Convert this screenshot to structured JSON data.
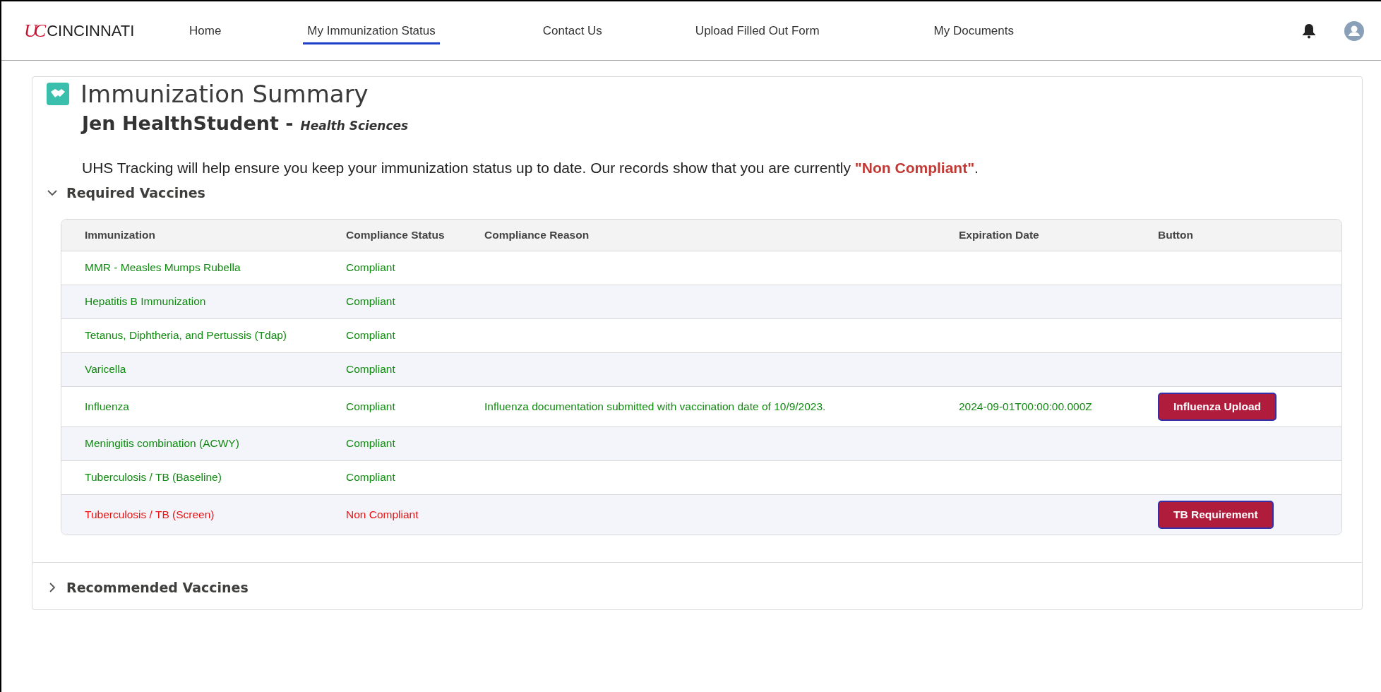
{
  "header": {
    "logo_mark": "UC",
    "logo_text": "CINCINNATI",
    "nav": [
      {
        "label": "Home",
        "selected": false
      },
      {
        "label": "My Immunization Status",
        "selected": true
      },
      {
        "label": "Contact Us",
        "selected": false
      },
      {
        "label": "Upload Filled Out Form",
        "selected": false
      },
      {
        "label": "My Documents",
        "selected": false
      }
    ]
  },
  "summary": {
    "title": "Immunization Summary",
    "student": "Jen HealthStudent -",
    "program": "Health Sciences",
    "message": "UHS Tracking will help ensure you keep your immunization status up to date. Our records show that you are currently **\"Non Compliant\"**.",
    "sections": [
      {
        "label": "Required Vaccines",
        "expanded": true,
        "table": {
          "columns": [
            "Immunization",
            "Compliance Status",
            "Compliance Reason",
            "Expiration Date",
            "Button"
          ],
          "rows": [
            {
              "immunization": "MMR - Measles Mumps Rubella",
              "status": "Compliant",
              "compliant": true
            },
            {
              "immunization": "Hepatitis B Immunization",
              "status": "Compliant",
              "compliant": true
            },
            {
              "immunization": "Tetanus, Diphtheria, and Pertussis (Tdap)",
              "status": "Compliant",
              "compliant": true
            },
            {
              "immunization": "Varicella",
              "status": "Compliant",
              "compliant": true
            },
            {
              "immunization": "Influenza",
              "status": "Compliant",
              "compliant": true,
              "reason": "Influenza documentation submitted with vaccination date of 10/9/2023.",
              "expiration": "2024-09-01T00:00:00.000Z",
              "button": "Influenza Upload"
            },
            {
              "immunization": "Meningitis combination (ACWY)",
              "status": "Compliant",
              "compliant": true
            },
            {
              "immunization": "Tuberculosis / TB (Baseline)",
              "status": "Compliant",
              "compliant": true
            },
            {
              "immunization": "Tuberculosis / TB (Screen)",
              "status": "Non Compliant",
              "compliant": false,
              "button": "TB Requirement"
            }
          ]
        }
      },
      {
        "label": "Recommended Vaccines",
        "expanded": false
      }
    ]
  }
}
